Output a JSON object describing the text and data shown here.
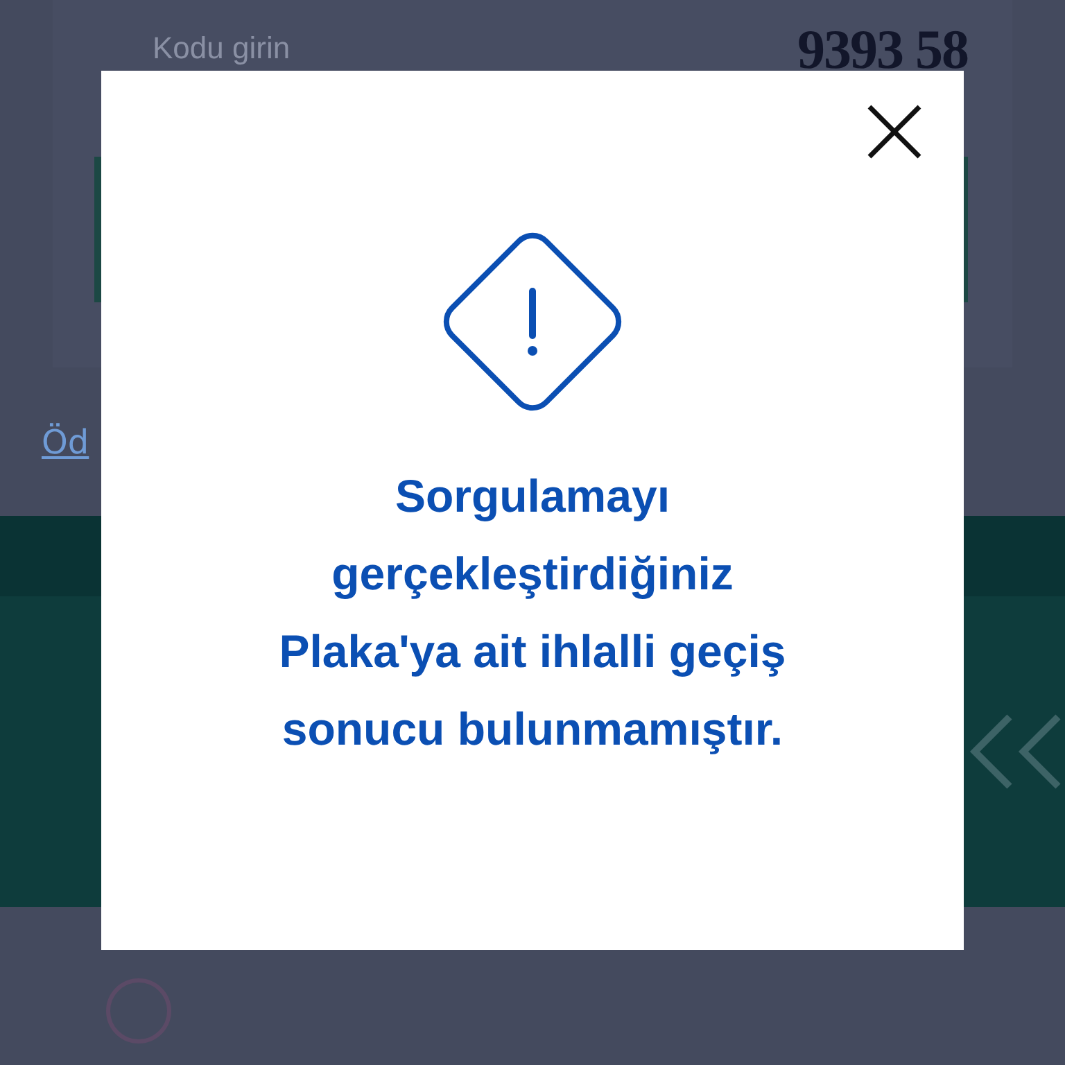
{
  "background": {
    "code_field": {
      "placeholder": "Kodu girin"
    },
    "captcha": "9393 58",
    "link": "Öd"
  },
  "modal": {
    "message": "Sorgulamayı\ngerçekleştirdiğiniz\nPlaka'ya ait ihlalli geçiş\nsonucu bulunmamıştır."
  }
}
